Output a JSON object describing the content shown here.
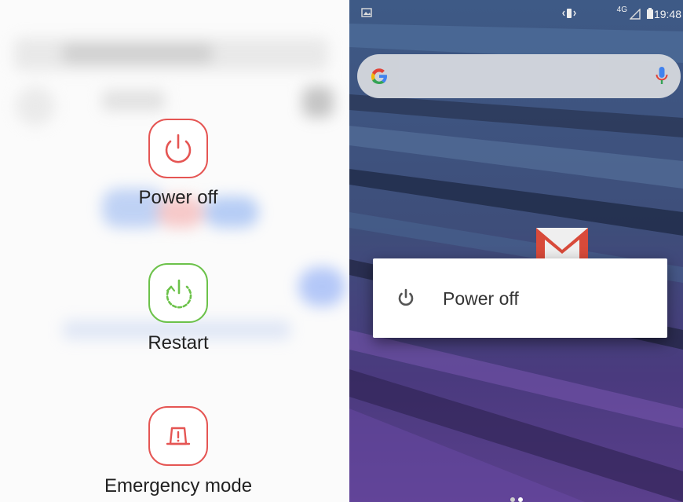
{
  "samsung_menu": {
    "power_off_label": "Power off",
    "restart_label": "Restart",
    "emergency_label": "Emergency mode",
    "colors": {
      "power": "#e55553",
      "restart": "#6cc24a",
      "emergency": "#e55553"
    }
  },
  "android": {
    "status_bar": {
      "time": "19:48",
      "network": "4G"
    },
    "search": {
      "logo": "google-g-icon",
      "mic": "mic-icon"
    },
    "dialog": {
      "label": "Power off"
    },
    "page_indicator": {
      "pages": 2,
      "active": 1
    }
  }
}
